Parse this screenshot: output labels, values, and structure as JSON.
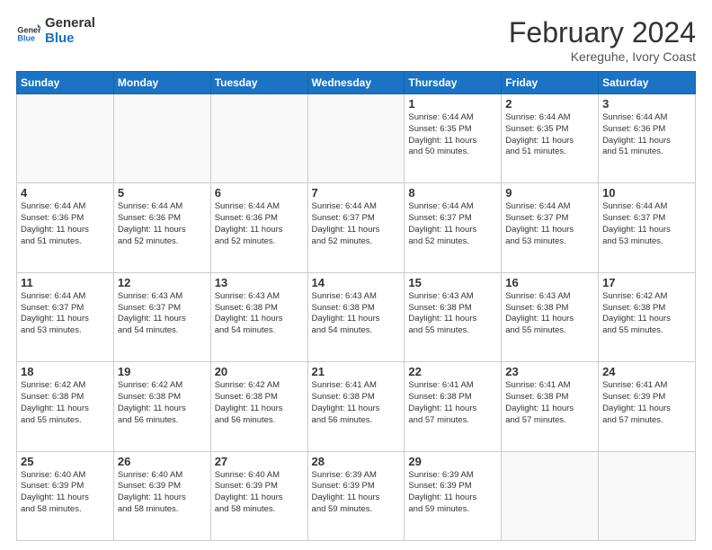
{
  "header": {
    "logo_general": "General",
    "logo_blue": "Blue",
    "month_title": "February 2024",
    "location": "Kereguhe, Ivory Coast"
  },
  "weekdays": [
    "Sunday",
    "Monday",
    "Tuesday",
    "Wednesday",
    "Thursday",
    "Friday",
    "Saturday"
  ],
  "weeks": [
    [
      {
        "day": "",
        "info": ""
      },
      {
        "day": "",
        "info": ""
      },
      {
        "day": "",
        "info": ""
      },
      {
        "day": "",
        "info": ""
      },
      {
        "day": "1",
        "info": "Sunrise: 6:44 AM\nSunset: 6:35 PM\nDaylight: 11 hours\nand 50 minutes."
      },
      {
        "day": "2",
        "info": "Sunrise: 6:44 AM\nSunset: 6:35 PM\nDaylight: 11 hours\nand 51 minutes."
      },
      {
        "day": "3",
        "info": "Sunrise: 6:44 AM\nSunset: 6:36 PM\nDaylight: 11 hours\nand 51 minutes."
      }
    ],
    [
      {
        "day": "4",
        "info": "Sunrise: 6:44 AM\nSunset: 6:36 PM\nDaylight: 11 hours\nand 51 minutes."
      },
      {
        "day": "5",
        "info": "Sunrise: 6:44 AM\nSunset: 6:36 PM\nDaylight: 11 hours\nand 52 minutes."
      },
      {
        "day": "6",
        "info": "Sunrise: 6:44 AM\nSunset: 6:36 PM\nDaylight: 11 hours\nand 52 minutes."
      },
      {
        "day": "7",
        "info": "Sunrise: 6:44 AM\nSunset: 6:37 PM\nDaylight: 11 hours\nand 52 minutes."
      },
      {
        "day": "8",
        "info": "Sunrise: 6:44 AM\nSunset: 6:37 PM\nDaylight: 11 hours\nand 52 minutes."
      },
      {
        "day": "9",
        "info": "Sunrise: 6:44 AM\nSunset: 6:37 PM\nDaylight: 11 hours\nand 53 minutes."
      },
      {
        "day": "10",
        "info": "Sunrise: 6:44 AM\nSunset: 6:37 PM\nDaylight: 11 hours\nand 53 minutes."
      }
    ],
    [
      {
        "day": "11",
        "info": "Sunrise: 6:44 AM\nSunset: 6:37 PM\nDaylight: 11 hours\nand 53 minutes."
      },
      {
        "day": "12",
        "info": "Sunrise: 6:43 AM\nSunset: 6:37 PM\nDaylight: 11 hours\nand 54 minutes."
      },
      {
        "day": "13",
        "info": "Sunrise: 6:43 AM\nSunset: 6:38 PM\nDaylight: 11 hours\nand 54 minutes."
      },
      {
        "day": "14",
        "info": "Sunrise: 6:43 AM\nSunset: 6:38 PM\nDaylight: 11 hours\nand 54 minutes."
      },
      {
        "day": "15",
        "info": "Sunrise: 6:43 AM\nSunset: 6:38 PM\nDaylight: 11 hours\nand 55 minutes."
      },
      {
        "day": "16",
        "info": "Sunrise: 6:43 AM\nSunset: 6:38 PM\nDaylight: 11 hours\nand 55 minutes."
      },
      {
        "day": "17",
        "info": "Sunrise: 6:42 AM\nSunset: 6:38 PM\nDaylight: 11 hours\nand 55 minutes."
      }
    ],
    [
      {
        "day": "18",
        "info": "Sunrise: 6:42 AM\nSunset: 6:38 PM\nDaylight: 11 hours\nand 55 minutes."
      },
      {
        "day": "19",
        "info": "Sunrise: 6:42 AM\nSunset: 6:38 PM\nDaylight: 11 hours\nand 56 minutes."
      },
      {
        "day": "20",
        "info": "Sunrise: 6:42 AM\nSunset: 6:38 PM\nDaylight: 11 hours\nand 56 minutes."
      },
      {
        "day": "21",
        "info": "Sunrise: 6:41 AM\nSunset: 6:38 PM\nDaylight: 11 hours\nand 56 minutes."
      },
      {
        "day": "22",
        "info": "Sunrise: 6:41 AM\nSunset: 6:38 PM\nDaylight: 11 hours\nand 57 minutes."
      },
      {
        "day": "23",
        "info": "Sunrise: 6:41 AM\nSunset: 6:38 PM\nDaylight: 11 hours\nand 57 minutes."
      },
      {
        "day": "24",
        "info": "Sunrise: 6:41 AM\nSunset: 6:39 PM\nDaylight: 11 hours\nand 57 minutes."
      }
    ],
    [
      {
        "day": "25",
        "info": "Sunrise: 6:40 AM\nSunset: 6:39 PM\nDaylight: 11 hours\nand 58 minutes."
      },
      {
        "day": "26",
        "info": "Sunrise: 6:40 AM\nSunset: 6:39 PM\nDaylight: 11 hours\nand 58 minutes."
      },
      {
        "day": "27",
        "info": "Sunrise: 6:40 AM\nSunset: 6:39 PM\nDaylight: 11 hours\nand 58 minutes."
      },
      {
        "day": "28",
        "info": "Sunrise: 6:39 AM\nSunset: 6:39 PM\nDaylight: 11 hours\nand 59 minutes."
      },
      {
        "day": "29",
        "info": "Sunrise: 6:39 AM\nSunset: 6:39 PM\nDaylight: 11 hours\nand 59 minutes."
      },
      {
        "day": "",
        "info": ""
      },
      {
        "day": "",
        "info": ""
      }
    ]
  ]
}
